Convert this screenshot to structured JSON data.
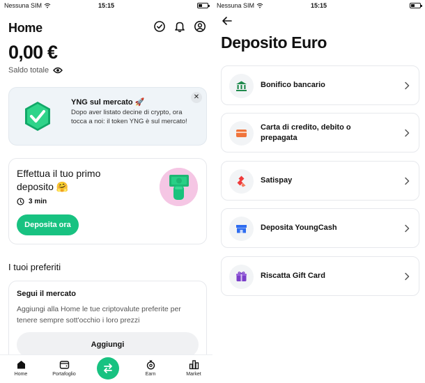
{
  "left": {
    "status": {
      "carrier": "Nessuna SIM",
      "time": "15:15"
    },
    "header": {
      "title": "Home"
    },
    "balance": {
      "amount": "0,00 €",
      "label": "Saldo totale"
    },
    "promo": {
      "title": "YNG sul mercato 🚀",
      "body": "Dopo aver listato decine di crypto, ora tocca a noi: il token YNG è sul mercato!",
      "close": "✕"
    },
    "first_deposit": {
      "title": "Effettua il tuo primo deposito 🤗",
      "duration": "3 min",
      "button": "Deposita ora"
    },
    "favorites": {
      "section_title": "I tuoi preferiti",
      "card_title": "Segui il mercato",
      "card_body": "Aggiungi alla Home le tue criptovalute preferite per tenere sempre sott'occhio i loro prezzi",
      "button": "Aggiungi"
    },
    "tabbar": {
      "items": [
        {
          "label": "Home",
          "icon": "home-icon"
        },
        {
          "label": "Portafoglio",
          "icon": "wallet-icon"
        },
        {
          "label": "",
          "icon": "swap-icon"
        },
        {
          "label": "Earn",
          "icon": "earn-icon"
        },
        {
          "label": "Market",
          "icon": "market-icon"
        }
      ]
    }
  },
  "right": {
    "status": {
      "carrier": "Nessuna SIM",
      "time": "15:15"
    },
    "title": "Deposito Euro",
    "methods": [
      {
        "label": "Bonifico bancario",
        "icon": "bank-icon",
        "color": "#1f8a4c"
      },
      {
        "label": "Carta di credito, debito o prepagata",
        "icon": "card-icon",
        "color": "#f0743b"
      },
      {
        "label": "Satispay",
        "icon": "satispay-icon",
        "color": "#ef3b3b"
      },
      {
        "label": "Deposita YoungCash",
        "icon": "store-icon",
        "color": "#2f6df0"
      },
      {
        "label": "Riscatta Gift Card",
        "icon": "gift-icon",
        "color": "#7b3fc9"
      }
    ]
  },
  "colors": {
    "accent": "#18c281",
    "promo_bg": "#eff4f8",
    "deposit_art_bg": "#f5c6e4"
  }
}
